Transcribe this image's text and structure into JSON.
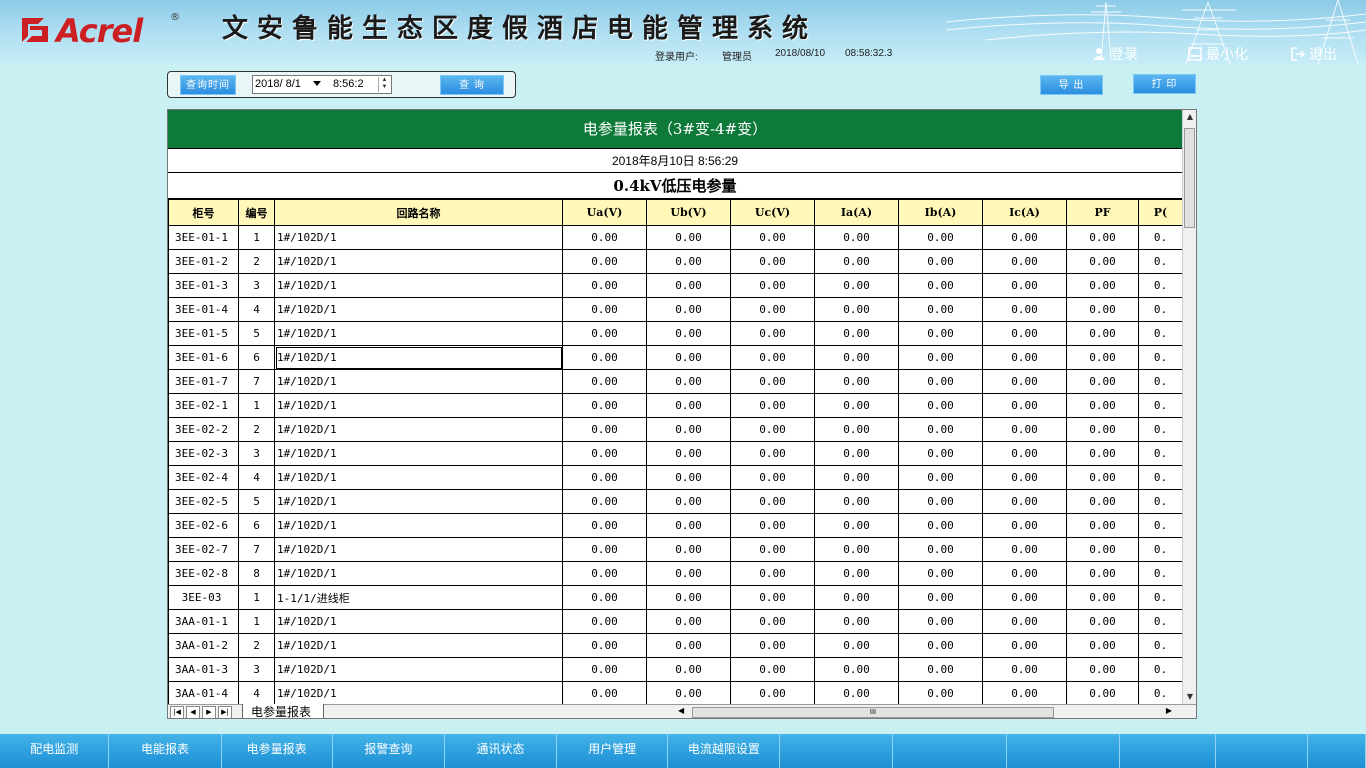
{
  "header": {
    "logo_text": "Acrel",
    "logo_reg": "®",
    "system_title": "文安鲁能生态区度假酒店电能管理系统",
    "login_user_label": "登录用户:",
    "login_user_value": "管理员",
    "login_date": "2018/08/10",
    "login_time": "08:58:32.3",
    "buttons": {
      "login": "登录",
      "minimize": "最小化",
      "exit": "退出"
    }
  },
  "query": {
    "time_label": "查询时间",
    "date_value": "2018/ 8/1",
    "time_value": "8:56:2",
    "query_button": "查 询",
    "export_button": "导 出",
    "print_button": "打 印"
  },
  "report": {
    "title": "电参量报表（3#变-4#变）",
    "datetime": "2018年8月10日  8:56:29",
    "subtitle": "0.4kV低压电参量",
    "columns": [
      "柜号",
      "编号",
      "回路名称",
      "Ua(V)",
      "Ub(V)",
      "Uc(V)",
      "Ia(A)",
      "Ib(A)",
      "Ic(A)",
      "PF",
      "P("
    ],
    "rows": [
      [
        "3EE-01-1",
        "1",
        "1#/102D/1",
        "0.00",
        "0.00",
        "0.00",
        "0.00",
        "0.00",
        "0.00",
        "0.00",
        "0."
      ],
      [
        "3EE-01-2",
        "2",
        "1#/102D/1",
        "0.00",
        "0.00",
        "0.00",
        "0.00",
        "0.00",
        "0.00",
        "0.00",
        "0."
      ],
      [
        "3EE-01-3",
        "3",
        "1#/102D/1",
        "0.00",
        "0.00",
        "0.00",
        "0.00",
        "0.00",
        "0.00",
        "0.00",
        "0."
      ],
      [
        "3EE-01-4",
        "4",
        "1#/102D/1",
        "0.00",
        "0.00",
        "0.00",
        "0.00",
        "0.00",
        "0.00",
        "0.00",
        "0."
      ],
      [
        "3EE-01-5",
        "5",
        "1#/102D/1",
        "0.00",
        "0.00",
        "0.00",
        "0.00",
        "0.00",
        "0.00",
        "0.00",
        "0."
      ],
      [
        "3EE-01-6",
        "6",
        "1#/102D/1",
        "0.00",
        "0.00",
        "0.00",
        "0.00",
        "0.00",
        "0.00",
        "0.00",
        "0."
      ],
      [
        "3EE-01-7",
        "7",
        "1#/102D/1",
        "0.00",
        "0.00",
        "0.00",
        "0.00",
        "0.00",
        "0.00",
        "0.00",
        "0."
      ],
      [
        "3EE-02-1",
        "1",
        "1#/102D/1",
        "0.00",
        "0.00",
        "0.00",
        "0.00",
        "0.00",
        "0.00",
        "0.00",
        "0."
      ],
      [
        "3EE-02-2",
        "2",
        "1#/102D/1",
        "0.00",
        "0.00",
        "0.00",
        "0.00",
        "0.00",
        "0.00",
        "0.00",
        "0."
      ],
      [
        "3EE-02-3",
        "3",
        "1#/102D/1",
        "0.00",
        "0.00",
        "0.00",
        "0.00",
        "0.00",
        "0.00",
        "0.00",
        "0."
      ],
      [
        "3EE-02-4",
        "4",
        "1#/102D/1",
        "0.00",
        "0.00",
        "0.00",
        "0.00",
        "0.00",
        "0.00",
        "0.00",
        "0."
      ],
      [
        "3EE-02-5",
        "5",
        "1#/102D/1",
        "0.00",
        "0.00",
        "0.00",
        "0.00",
        "0.00",
        "0.00",
        "0.00",
        "0."
      ],
      [
        "3EE-02-6",
        "6",
        "1#/102D/1",
        "0.00",
        "0.00",
        "0.00",
        "0.00",
        "0.00",
        "0.00",
        "0.00",
        "0."
      ],
      [
        "3EE-02-7",
        "7",
        "1#/102D/1",
        "0.00",
        "0.00",
        "0.00",
        "0.00",
        "0.00",
        "0.00",
        "0.00",
        "0."
      ],
      [
        "3EE-02-8",
        "8",
        "1#/102D/1",
        "0.00",
        "0.00",
        "0.00",
        "0.00",
        "0.00",
        "0.00",
        "0.00",
        "0."
      ],
      [
        "3EE-03",
        "1",
        "1-1/1/进线柜",
        "0.00",
        "0.00",
        "0.00",
        "0.00",
        "0.00",
        "0.00",
        "0.00",
        "0."
      ],
      [
        "3AA-01-1",
        "1",
        "1#/102D/1",
        "0.00",
        "0.00",
        "0.00",
        "0.00",
        "0.00",
        "0.00",
        "0.00",
        "0."
      ],
      [
        "3AA-01-2",
        "2",
        "1#/102D/1",
        "0.00",
        "0.00",
        "0.00",
        "0.00",
        "0.00",
        "0.00",
        "0.00",
        "0."
      ],
      [
        "3AA-01-3",
        "3",
        "1#/102D/1",
        "0.00",
        "0.00",
        "0.00",
        "0.00",
        "0.00",
        "0.00",
        "0.00",
        "0."
      ],
      [
        "3AA-01-4",
        "4",
        "1#/102D/1",
        "0.00",
        "0.00",
        "0.00",
        "0.00",
        "0.00",
        "0.00",
        "0.00",
        "0."
      ]
    ],
    "sheet_tab": "电参量报表",
    "scroll_grip": "III"
  },
  "nav": {
    "items": [
      "配电监测",
      "电能报表",
      "电参量报表",
      "报警查询",
      "通讯状态",
      "用户管理",
      "电流越限设置",
      "",
      "",
      "",
      "",
      "",
      ""
    ]
  },
  "colors": {
    "title_green": "#0e7a39",
    "header_yellow": "#fff8b8",
    "name_green": "#207a20",
    "nav_blue": "#2a9fe0",
    "bg": "#c9f1f3",
    "logo_red": "#cc1f24"
  }
}
